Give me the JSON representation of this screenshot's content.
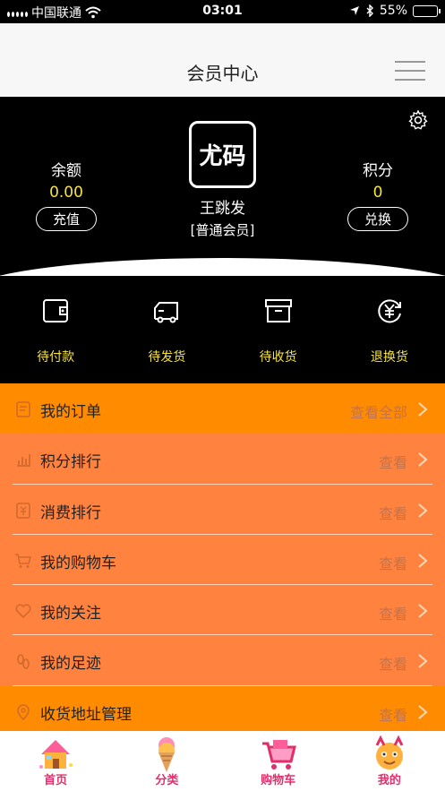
{
  "status_bar": {
    "carrier": "中国联通",
    "time": "03:01",
    "battery": "55%",
    "battery_level": 0.55
  },
  "header": {
    "title": "会员中心"
  },
  "profile": {
    "balance_label": "余额",
    "balance_value": "0.00",
    "recharge_button": "充值",
    "avatar_text": "尤码",
    "username": "王跳发",
    "level": "[普通会员]",
    "points_label": "积分",
    "points_value": "0",
    "exchange_button": "兑换"
  },
  "quick_orders": [
    {
      "label": "待付款",
      "icon": "wallet-icon"
    },
    {
      "label": "待发货",
      "icon": "truck-icon"
    },
    {
      "label": "待收货",
      "icon": "box-icon"
    },
    {
      "label": "退换货",
      "icon": "yen-refund-icon"
    }
  ],
  "menu": {
    "my_orders": {
      "label": "我的订单",
      "more": "查看全部",
      "icon": "order-icon"
    },
    "points_rank": {
      "label": "积分排行",
      "more": "查看",
      "icon": "bar-chart-icon"
    },
    "spend_rank": {
      "label": "消费排行",
      "more": "查看",
      "icon": "receipt-icon"
    },
    "cart": {
      "label": "我的购物车",
      "more": "查看",
      "icon": "cart-icon"
    },
    "follows": {
      "label": "我的关注",
      "more": "查看",
      "icon": "heart-icon"
    },
    "footprints": {
      "label": "我的足迹",
      "more": "查看",
      "icon": "footprint-icon"
    },
    "address": {
      "label": "收货地址管理",
      "more": "查看",
      "icon": "location-icon"
    }
  },
  "tabbar": [
    {
      "label": "首页",
      "icon": "house-icon"
    },
    {
      "label": "分类",
      "icon": "ice-cream-icon"
    },
    {
      "label": "购物车",
      "icon": "shopping-cart-icon"
    },
    {
      "label": "我的",
      "icon": "mascot-icon"
    }
  ],
  "colors": {
    "accent_yellow": "#f5e33c",
    "list_orange": "#ff823f",
    "highlight_orange": "#ff8b00",
    "tab_label_pink": "#e0306a"
  }
}
